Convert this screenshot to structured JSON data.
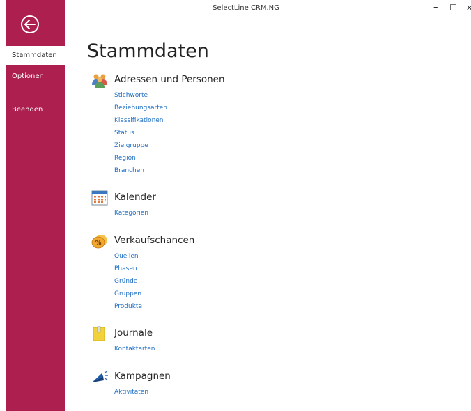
{
  "window": {
    "title": "SelectLine CRM.NG",
    "minimize": "–",
    "maximize": "☐",
    "close": "✕"
  },
  "sidebar": {
    "items": [
      {
        "label": "Stammdaten"
      },
      {
        "label": "Optionen"
      },
      {
        "label": "Beenden"
      }
    ]
  },
  "colors": {
    "sidebar": "#ad1f4e",
    "link": "#1f6fc5"
  },
  "page_title": "Stammdaten",
  "sections": [
    {
      "title": "Adressen und Personen",
      "icon": "people-icon",
      "links": [
        "Stichworte",
        "Beziehungsarten",
        "Klassifikationen",
        "Status",
        "Zielgruppe",
        "Region",
        "Branchen"
      ]
    },
    {
      "title": "Kalender",
      "icon": "calendar-icon",
      "links": [
        "Kategorien"
      ]
    },
    {
      "title": "Verkaufschancen",
      "icon": "percent-coin-icon",
      "links": [
        "Quellen",
        "Phasen",
        "Gründe",
        "Gruppen",
        "Produkte"
      ]
    },
    {
      "title": "Journale",
      "icon": "journal-icon",
      "links": [
        "Kontaktarten"
      ]
    },
    {
      "title": "Kampagnen",
      "icon": "megaphone-icon",
      "links": [
        "Aktivitäten"
      ]
    }
  ]
}
